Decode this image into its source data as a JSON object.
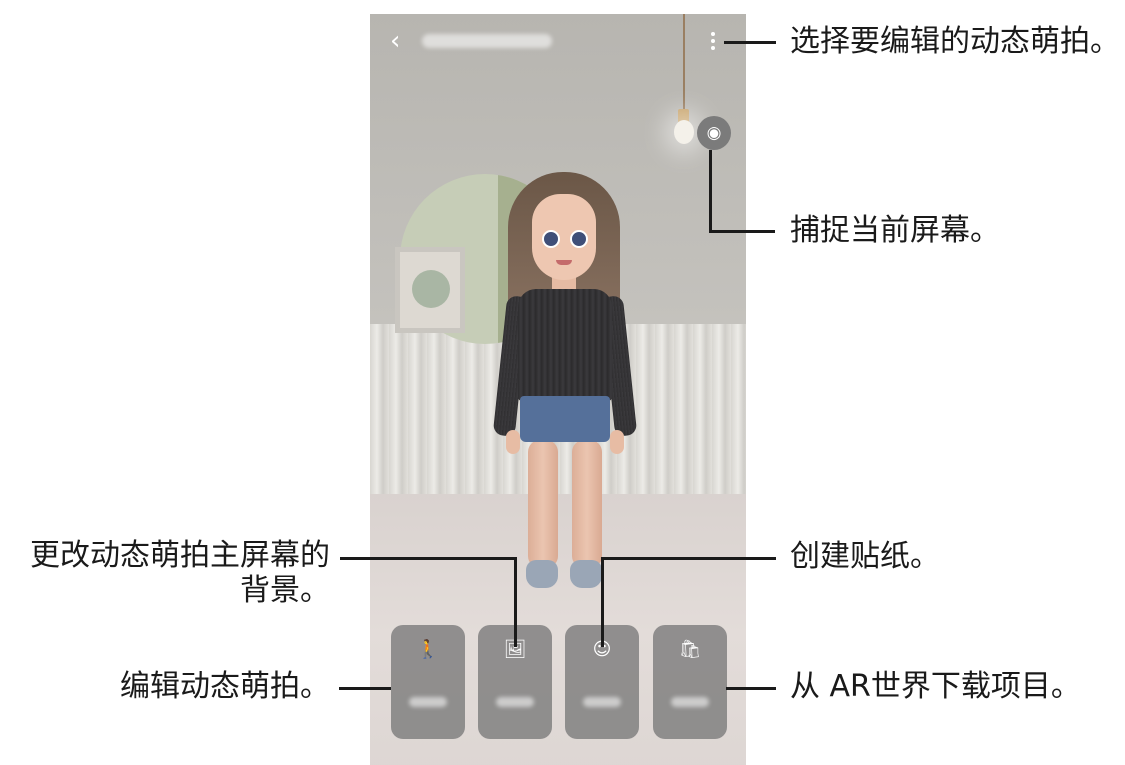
{
  "screen": {
    "back_icon": "chevron-left-icon",
    "title": "",
    "more_icon": "more-vertical-icon",
    "capture_icon": "face-capture-icon"
  },
  "menu": [
    {
      "icon": "person-icon",
      "glyph": "🚶",
      "label": ""
    },
    {
      "icon": "image-icon",
      "glyph": "🖼",
      "label": ""
    },
    {
      "icon": "sticker-icon",
      "glyph": "☺",
      "label": ""
    },
    {
      "icon": "shopping-bag-icon",
      "glyph": "🛍",
      "label": ""
    }
  ],
  "callouts": {
    "more_options": "选择要编辑的动态萌拍。",
    "capture": "捕捉当前屏幕。",
    "background_line1": "更改动态萌拍主屏幕的",
    "background_line2": "背景。",
    "sticker": "创建贴纸。",
    "edit": "编辑动态萌拍。",
    "download": "从 AR世界下载项目。"
  }
}
